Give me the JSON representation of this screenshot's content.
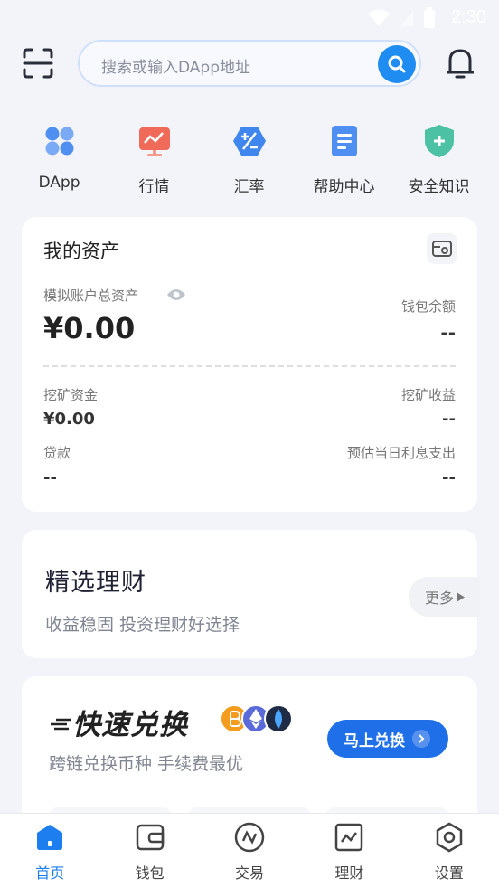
{
  "status_bar": {
    "time": "2:30"
  },
  "search": {
    "placeholder": "搜索或输入DApp地址"
  },
  "quick_links": [
    {
      "label": "DApp",
      "icon": "apps-grid-icon"
    },
    {
      "label": "行情",
      "icon": "market-chart-icon"
    },
    {
      "label": "汇率",
      "icon": "exchange-rate-icon"
    },
    {
      "label": "帮助中心",
      "icon": "help-doc-icon"
    },
    {
      "label": "安全知识",
      "icon": "security-shield-icon"
    }
  ],
  "assets": {
    "title": "我的资产",
    "total_label": "模拟账户总资产",
    "total_value": "¥0.00",
    "wallet_label": "钱包余额",
    "wallet_value": "--",
    "mining_funds_label": "挖矿资金",
    "mining_funds_value": "¥0.00",
    "mining_income_label": "挖矿收益",
    "mining_income_value": "--",
    "loan_label": "贷款",
    "loan_value": "--",
    "interest_label": "预估当日利息支出",
    "interest_value": "--"
  },
  "finance": {
    "title": "精选理财",
    "subtitle": "收益稳固 投资理财好选择",
    "more_label": "更多"
  },
  "swap": {
    "title": "快速兑换",
    "subtitle": "跨链兑换币种 手续费最优",
    "button_label": "马上兑换"
  },
  "tabs": [
    {
      "label": "首页",
      "active": true
    },
    {
      "label": "钱包",
      "active": false
    },
    {
      "label": "交易",
      "active": false
    },
    {
      "label": "理财",
      "active": false
    },
    {
      "label": "设置",
      "active": false
    }
  ],
  "colors": {
    "accent": "#1f8cf2",
    "tab_active": "#1d7ef0",
    "background": "#f3f4f9"
  }
}
